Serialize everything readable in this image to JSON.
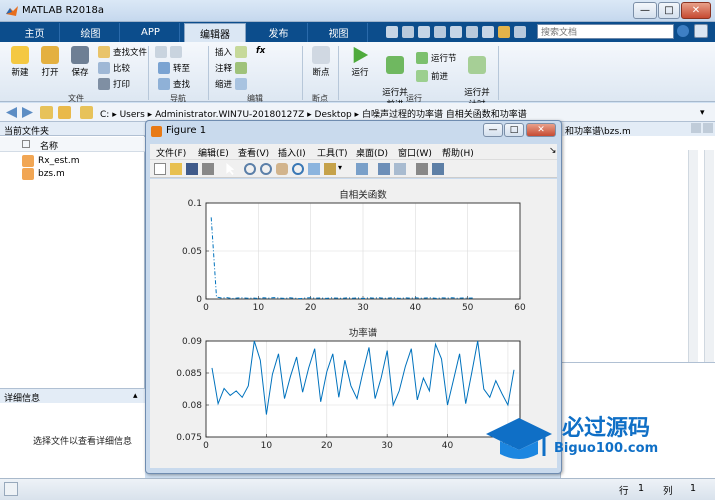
{
  "app": {
    "title": "MATLAB R2018a"
  },
  "window_controls": {
    "minimize": "—",
    "maximize": "□",
    "close": "✕"
  },
  "tabs": [
    {
      "label": "主页"
    },
    {
      "label": "绘图"
    },
    {
      "label": "APP"
    },
    {
      "label": "编辑器",
      "active": true
    },
    {
      "label": "发布"
    },
    {
      "label": "视图"
    }
  ],
  "search": {
    "placeholder": "搜索文档"
  },
  "ribbon": {
    "file_group": {
      "new": "新建",
      "open": "打开",
      "save": "保存",
      "find_files": "查找文件",
      "compare": "比较",
      "print": "打印",
      "label": "文件"
    },
    "nav_group": {
      "goto": "转至",
      "find": "查找",
      "label": "导航"
    },
    "edit_group": {
      "insert": "插入",
      "comment": "注释",
      "indent": "缩进",
      "fx": "fx",
      "label": "编辑"
    },
    "breakpoint_group": {
      "breakpoints": "断点",
      "label": "断点"
    },
    "run_group": {
      "run": "运行",
      "run_advance": "运行并\n前进",
      "run_section": "运行节",
      "advance": "前进",
      "run_time": "运行并\n计时",
      "label": "运行"
    }
  },
  "address": {
    "crumbs": [
      "C:",
      "Users",
      "Administrator.WIN7U-20180127Z",
      "Desktop",
      "白噪声过程的功率谱 自相关函数和功率谱"
    ]
  },
  "left_panel": {
    "title": "当前文件夹",
    "column": "名称",
    "files": [
      "Rx_est.m",
      "bzs.m"
    ]
  },
  "details": {
    "title": "详细信息",
    "message": "选择文件以查看详细信息"
  },
  "right_panel": {
    "title": "和功率谱\\bzs.m"
  },
  "status": {
    "row_label": "行",
    "row": "1",
    "col_label": "列",
    "col": "1"
  },
  "figure": {
    "title": "Figure 1",
    "menus": [
      "文件(F)",
      "编辑(E)",
      "查看(V)",
      "插入(I)",
      "工具(T)",
      "桌面(D)",
      "窗口(W)",
      "帮助(H)"
    ]
  },
  "chart_data": [
    {
      "type": "line",
      "title": "自相关函数",
      "xlim": [
        0,
        60
      ],
      "ylim": [
        0,
        0.1
      ],
      "xticks": [
        0,
        10,
        20,
        30,
        40,
        50,
        60
      ],
      "yticks": [
        0,
        0.05,
        0.1
      ],
      "grid": true,
      "line_style": "dash-dot",
      "color": "#0072bd",
      "x": [
        1,
        2,
        3,
        4,
        5,
        6,
        7,
        8,
        9,
        10,
        11,
        12,
        13,
        14,
        15,
        16,
        17,
        18,
        19,
        20,
        21,
        22,
        23,
        24,
        25,
        26,
        27,
        28,
        29,
        30,
        31,
        32,
        33,
        34,
        35,
        36,
        37,
        38,
        39,
        40,
        41,
        42,
        43,
        44,
        45,
        46,
        47,
        48,
        49,
        50,
        51
      ],
      "y": [
        0.085,
        0.002,
        0.001,
        0.0015,
        0.0005,
        0.001,
        0.0012,
        0.0008,
        0.001,
        0.0005,
        0.0012,
        0.0009,
        0.0015,
        0.001,
        0.0006,
        0.0012,
        0.0008,
        0.0004,
        0.001,
        0.0014,
        0.0008,
        0.0011,
        0.0006,
        0.0012,
        0.0009,
        0.0007,
        0.0013,
        0.0008,
        0.0011,
        0.0005,
        0.0012,
        0.0009,
        0.0014,
        0.0007,
        0.001,
        0.0012,
        0.0006,
        0.0011,
        0.0009,
        0.0013,
        0.0008,
        0.001,
        0.0012,
        0.0006,
        0.0011,
        0.0009,
        0.0013,
        0.0007,
        0.001,
        0.0008,
        0.001
      ]
    },
    {
      "type": "line",
      "title": "功率谱",
      "xlim": [
        0,
        52
      ],
      "ylim": [
        0.075,
        0.09
      ],
      "xticks": [
        0,
        10,
        20,
        30,
        40,
        50
      ],
      "yticks": [
        0.075,
        0.08,
        0.085,
        0.09
      ],
      "grid": true,
      "line_style": "solid",
      "color": "#0072bd",
      "x": [
        1,
        2,
        3,
        4,
        5,
        6,
        7,
        8,
        9,
        10,
        11,
        12,
        13,
        14,
        15,
        16,
        17,
        18,
        19,
        20,
        21,
        22,
        23,
        24,
        25,
        26,
        27,
        28,
        29,
        30,
        31,
        32,
        33,
        34,
        35,
        36,
        37,
        38,
        39,
        40,
        41,
        42,
        43,
        44,
        45,
        46,
        47,
        48,
        49,
        50,
        51
      ],
      "y": [
        0.0858,
        0.0802,
        0.0826,
        0.0815,
        0.0822,
        0.0812,
        0.083,
        0.09,
        0.087,
        0.0785,
        0.0848,
        0.088,
        0.081,
        0.0845,
        0.0875,
        0.082,
        0.0858,
        0.0888,
        0.0805,
        0.0852,
        0.088,
        0.0812,
        0.087,
        0.083,
        0.081,
        0.0852,
        0.089,
        0.081,
        0.0842,
        0.0885,
        0.08,
        0.0822,
        0.086,
        0.0888,
        0.0808,
        0.0842,
        0.0822,
        0.0895,
        0.0872,
        0.08,
        0.084,
        0.088,
        0.0802,
        0.085,
        0.09,
        0.0825,
        0.0812,
        0.0838,
        0.0818,
        0.08,
        0.0855
      ]
    }
  ],
  "watermark": {
    "brand": "必过源码",
    "url": "Biguo100.com"
  }
}
